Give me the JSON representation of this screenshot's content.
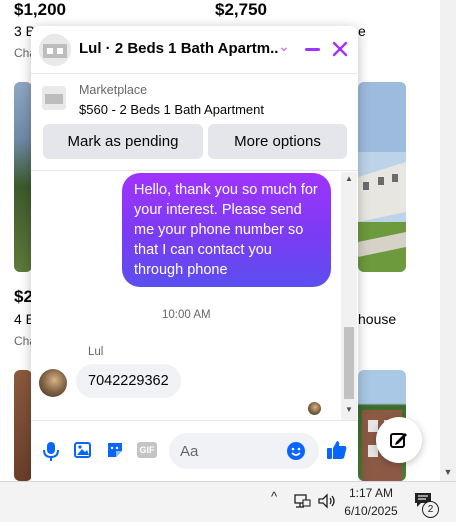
{
  "listings": {
    "top": [
      {
        "price": "$1,200",
        "title": "3 B",
        "location": "Cha"
      },
      {
        "price": "$2,750",
        "title": "e"
      }
    ],
    "middle": [
      {
        "price": "$2",
        "title": "4 E",
        "location": "Cha"
      },
      {
        "title": "house"
      }
    ]
  },
  "chat": {
    "title": "Lul · 2 Beds 1 Bath Apartm...",
    "marketplace_label": "Marketplace",
    "listing_line": "$560 - 2 Beds 1 Bath Apartment",
    "mark_pending_label": "Mark as pending",
    "more_options_label": "More options",
    "messages": {
      "outgoing_text": "Hello, thank you so much for your interest. Please send me your phone number so that I can contact you through phone",
      "timestamp": "10:00 AM",
      "sender_name": "Lul",
      "incoming_text": "7042229362"
    },
    "input_placeholder": "Aa",
    "accent_color": "#a033ff",
    "icon_color": "#0866ff"
  },
  "taskbar": {
    "time": "1:17 AM",
    "date": "6/10/2025",
    "notification_count": "2"
  }
}
